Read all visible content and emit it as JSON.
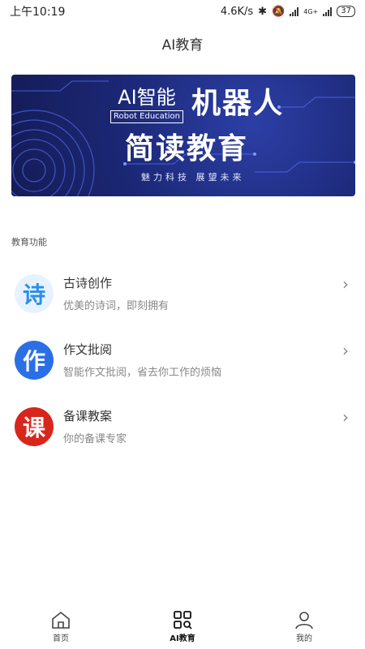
{
  "status": {
    "time": "上午10:19",
    "speed": "4.6K/s",
    "network": "4G+",
    "battery": "37"
  },
  "header": {
    "title": "AI教育"
  },
  "banner": {
    "ai": "AI智能",
    "robot_edu": "Robot Education",
    "line1": "机器人",
    "line2": "简读教育",
    "slogan": "魅力科技   展望未来"
  },
  "section": {
    "title": "教育功能"
  },
  "features": [
    {
      "icon_char": "诗",
      "name": "古诗创作",
      "desc": "优美的诗词，即刻拥有",
      "icon": "poem-icon",
      "icon_color": "#2c8ee8",
      "icon_bg": "#e6f3ff"
    },
    {
      "icon_char": "作",
      "name": "作文批阅",
      "desc": "智能作文批阅，省去你工作的烦恼",
      "icon": "essay-icon",
      "icon_color": "#ffffff",
      "icon_bg": "#2b6fe6"
    },
    {
      "icon_char": "课",
      "name": "备课教案",
      "desc": "你的备课专家",
      "icon": "lesson-icon",
      "icon_color": "#ffffff",
      "icon_bg": "#d8261c"
    }
  ],
  "tabs": [
    {
      "label": "首页",
      "icon": "home-icon",
      "active": false
    },
    {
      "label": "AI教育",
      "icon": "grid-search-icon",
      "active": true
    },
    {
      "label": "我的",
      "icon": "user-icon",
      "active": false
    }
  ]
}
